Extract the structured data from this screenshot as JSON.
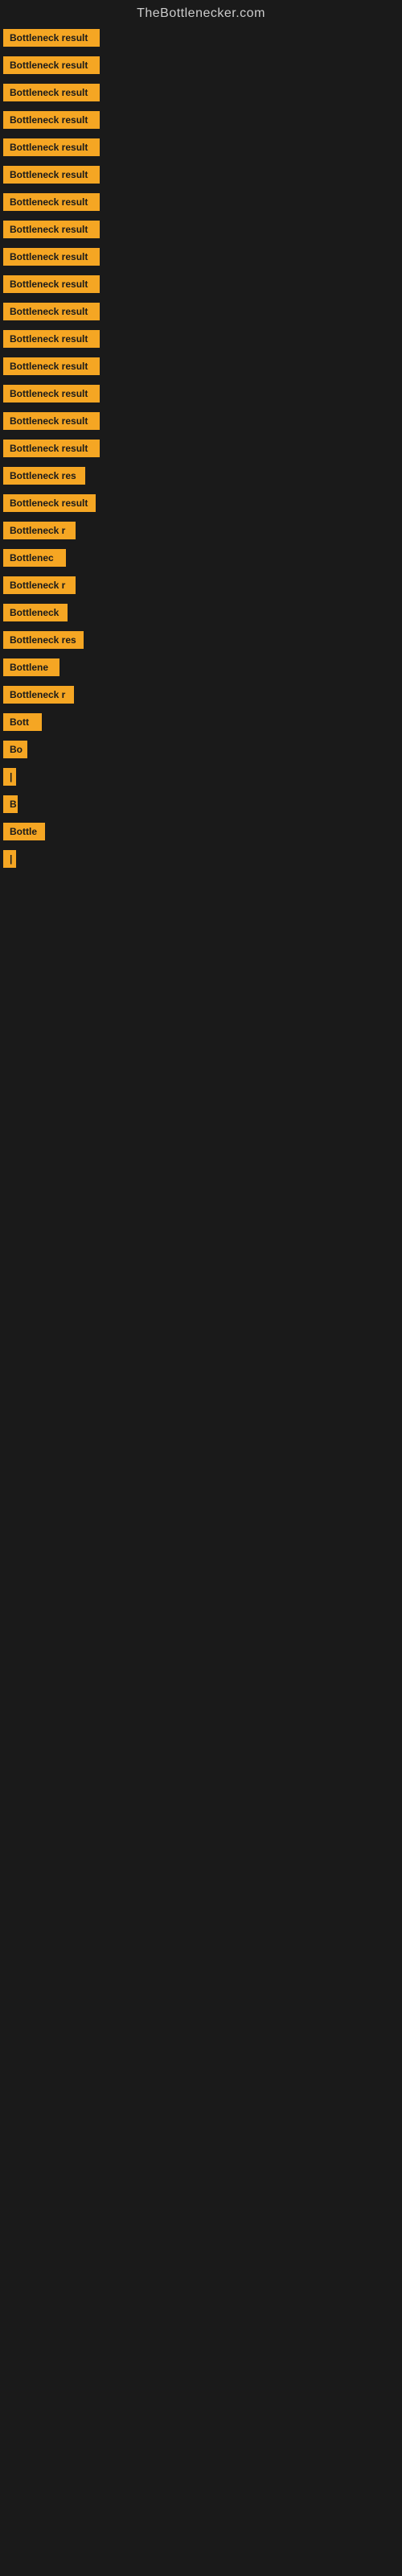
{
  "header": {
    "title": "TheBottlenecker.com"
  },
  "rows": [
    {
      "label": "Bottleneck result",
      "width": 120
    },
    {
      "label": "Bottleneck result",
      "width": 120
    },
    {
      "label": "Bottleneck result",
      "width": 120
    },
    {
      "label": "Bottleneck result",
      "width": 120
    },
    {
      "label": "Bottleneck result",
      "width": 120
    },
    {
      "label": "Bottleneck result",
      "width": 120
    },
    {
      "label": "Bottleneck result",
      "width": 120
    },
    {
      "label": "Bottleneck result",
      "width": 120
    },
    {
      "label": "Bottleneck result",
      "width": 120
    },
    {
      "label": "Bottleneck result",
      "width": 120
    },
    {
      "label": "Bottleneck result",
      "width": 120
    },
    {
      "label": "Bottleneck result",
      "width": 120
    },
    {
      "label": "Bottleneck result",
      "width": 120
    },
    {
      "label": "Bottleneck result",
      "width": 120
    },
    {
      "label": "Bottleneck result",
      "width": 120
    },
    {
      "label": "Bottleneck result",
      "width": 120
    },
    {
      "label": "Bottleneck res",
      "width": 102
    },
    {
      "label": "Bottleneck result",
      "width": 115
    },
    {
      "label": "Bottleneck r",
      "width": 90
    },
    {
      "label": "Bottlenec",
      "width": 78
    },
    {
      "label": "Bottleneck r",
      "width": 90
    },
    {
      "label": "Bottleneck",
      "width": 80
    },
    {
      "label": "Bottleneck res",
      "width": 100
    },
    {
      "label": "Bottlene",
      "width": 70
    },
    {
      "label": "Bottleneck r",
      "width": 88
    },
    {
      "label": "Bott",
      "width": 48
    },
    {
      "label": "Bo",
      "width": 30
    },
    {
      "label": "|",
      "width": 8
    },
    {
      "label": "B",
      "width": 18
    },
    {
      "label": "Bottle",
      "width": 52
    },
    {
      "label": "|",
      "width": 8
    }
  ]
}
